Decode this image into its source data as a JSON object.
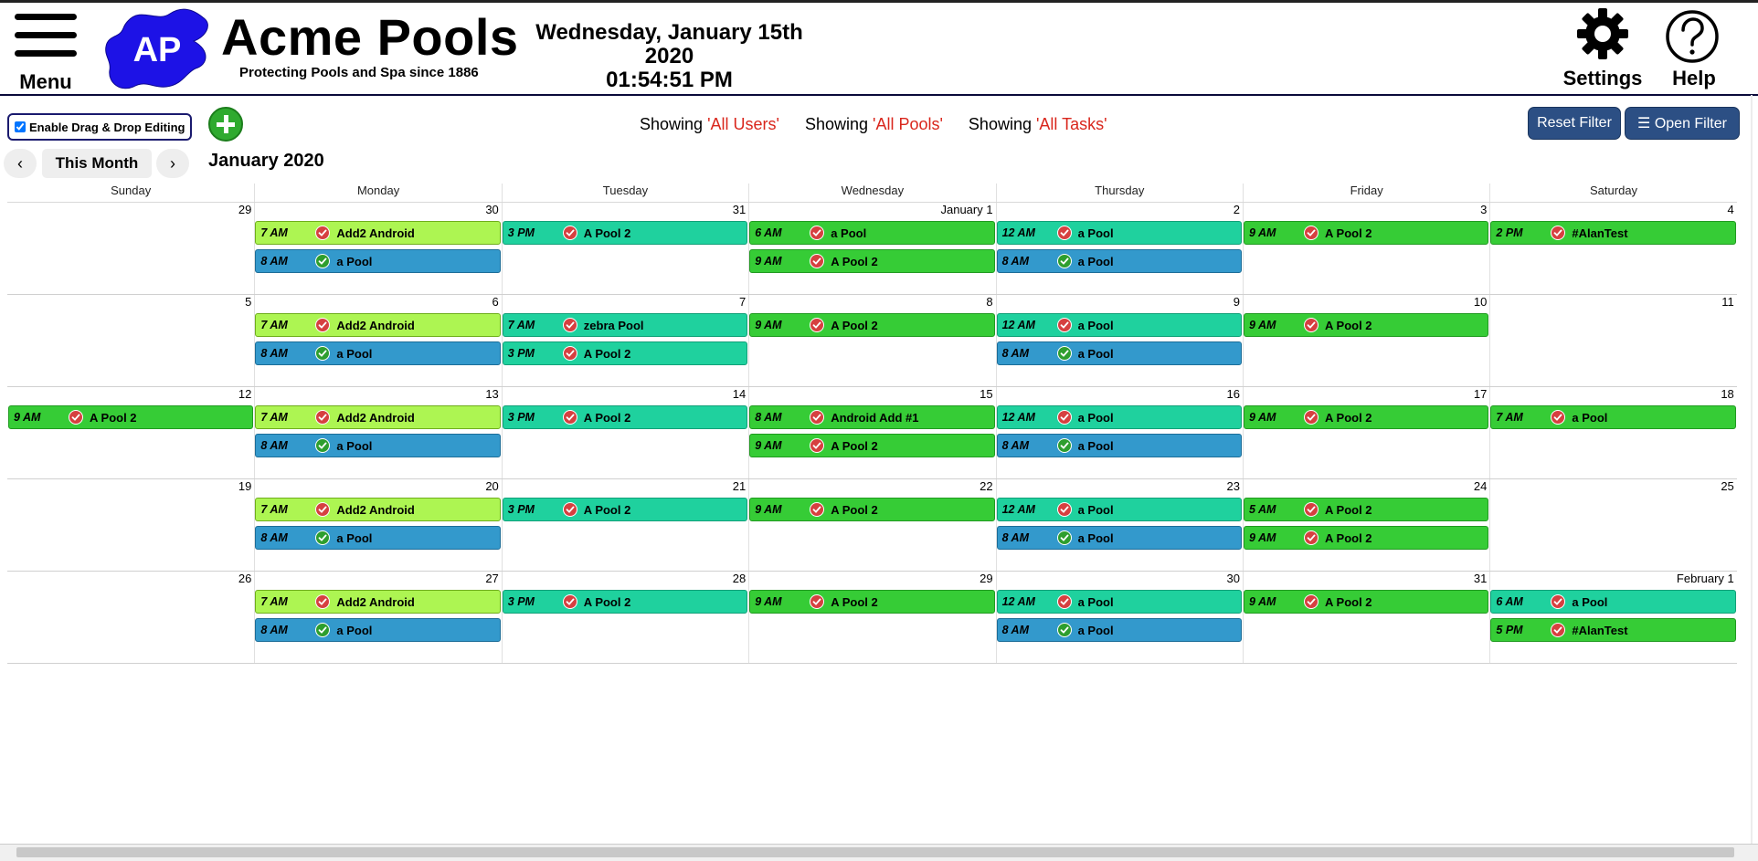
{
  "header": {
    "menu_label": "Menu",
    "logo_text": "AP",
    "brand": "Acme Pools",
    "tagline": "Protecting Pools and Spa since 1886",
    "date": "Wednesday, January 15th 2020",
    "time": "01:54:51 PM",
    "settings_label": "Settings",
    "help_label": "Help"
  },
  "toolbar": {
    "drag_drop_label": "Enable Drag & Drop Editing",
    "drag_drop_checked": true,
    "filters": [
      {
        "prefix": "Showing ",
        "value": "'All Users'"
      },
      {
        "prefix": "Showing ",
        "value": "'All Pools'"
      },
      {
        "prefix": "Showing ",
        "value": "'All Tasks'"
      }
    ],
    "reset_filter_label": "Reset Filter",
    "open_filter_label": "☰ Open Filter"
  },
  "nav": {
    "prev": "‹",
    "this_month": "This Month",
    "next": "›",
    "month_title": "January 2020"
  },
  "colors": {
    "lime": "#adf552",
    "teal": "#1fd19e",
    "green": "#36cc36",
    "blue": "#3399cc",
    "accent_red": "#d9261c",
    "button_blue": "#2c4f84"
  },
  "calendar": {
    "days_of_week": [
      "Sunday",
      "Monday",
      "Tuesday",
      "Wednesday",
      "Thursday",
      "Friday",
      "Saturday"
    ],
    "weeks": [
      {
        "days": [
          "29",
          "30",
          "31",
          "January 1",
          "2",
          "3",
          "4"
        ],
        "events": [
          {
            "day": 1,
            "row": 0,
            "span": 1,
            "time": "7 AM",
            "name": "Add2 Android",
            "color": "lime",
            "status": "red"
          },
          {
            "day": 1,
            "row": 1,
            "span": 1,
            "time": "8 AM",
            "name": "a Pool",
            "color": "blue",
            "status": "green"
          },
          {
            "day": 2,
            "row": 0,
            "span": 1,
            "time": "3 PM",
            "name": "A Pool 2",
            "color": "teal",
            "status": "red"
          },
          {
            "day": 3,
            "row": 0,
            "span": 1,
            "time": "6 AM",
            "name": "a Pool",
            "color": "green",
            "status": "red"
          },
          {
            "day": 3,
            "row": 1,
            "span": 1,
            "time": "9 AM",
            "name": "A Pool 2",
            "color": "green",
            "status": "red"
          },
          {
            "day": 4,
            "row": 0,
            "span": 1,
            "time": "12 AM",
            "name": "a Pool",
            "color": "teal",
            "status": "red"
          },
          {
            "day": 4,
            "row": 1,
            "span": 1,
            "time": "8 AM",
            "name": "a Pool",
            "color": "blue",
            "status": "green"
          },
          {
            "day": 5,
            "row": 0,
            "span": 1,
            "time": "9 AM",
            "name": "A Pool 2",
            "color": "green",
            "status": "red"
          },
          {
            "day": 6,
            "row": 0,
            "span": 1,
            "time": "2 PM",
            "name": "#AlanTest",
            "color": "green",
            "status": "red"
          }
        ]
      },
      {
        "days": [
          "5",
          "6",
          "7",
          "8",
          "9",
          "10",
          "11"
        ],
        "events": [
          {
            "day": 1,
            "row": 0,
            "span": 1,
            "time": "7 AM",
            "name": "Add2 Android",
            "color": "lime",
            "status": "red"
          },
          {
            "day": 1,
            "row": 1,
            "span": 1,
            "time": "8 AM",
            "name": "a Pool",
            "color": "blue",
            "status": "green"
          },
          {
            "day": 2,
            "row": 0,
            "span": 1,
            "time": "7 AM",
            "name": "zebra Pool",
            "color": "teal",
            "status": "red"
          },
          {
            "day": 2,
            "row": 1,
            "span": 1,
            "time": "3 PM",
            "name": "A Pool 2",
            "color": "teal",
            "status": "red"
          },
          {
            "day": 3,
            "row": 0,
            "span": 1,
            "time": "9 AM",
            "name": "A Pool 2",
            "color": "green",
            "status": "red"
          },
          {
            "day": 4,
            "row": 0,
            "span": 1,
            "time": "12 AM",
            "name": "a Pool",
            "color": "teal",
            "status": "red"
          },
          {
            "day": 4,
            "row": 1,
            "span": 1,
            "time": "8 AM",
            "name": "a Pool",
            "color": "blue",
            "status": "green"
          },
          {
            "day": 5,
            "row": 0,
            "span": 1,
            "time": "9 AM",
            "name": "A Pool 2",
            "color": "green",
            "status": "red"
          }
        ]
      },
      {
        "days": [
          "12",
          "13",
          "14",
          "15",
          "16",
          "17",
          "18"
        ],
        "events": [
          {
            "day": 0,
            "row": 0,
            "span": 1,
            "time": "9 AM",
            "name": "A Pool 2",
            "color": "green",
            "status": "red"
          },
          {
            "day": 1,
            "row": 0,
            "span": 1,
            "time": "7 AM",
            "name": "Add2 Android",
            "color": "lime",
            "status": "red"
          },
          {
            "day": 1,
            "row": 1,
            "span": 1,
            "time": "8 AM",
            "name": "a Pool",
            "color": "blue",
            "status": "green"
          },
          {
            "day": 2,
            "row": 0,
            "span": 1,
            "time": "3 PM",
            "name": "A Pool 2",
            "color": "teal",
            "status": "red"
          },
          {
            "day": 3,
            "row": 0,
            "span": 1,
            "time": "8 AM",
            "name": "Android Add #1",
            "color": "green",
            "status": "red"
          },
          {
            "day": 3,
            "row": 1,
            "span": 1,
            "time": "9 AM",
            "name": "A Pool 2",
            "color": "green",
            "status": "red"
          },
          {
            "day": 4,
            "row": 0,
            "span": 1,
            "time": "12 AM",
            "name": "a Pool",
            "color": "teal",
            "status": "red"
          },
          {
            "day": 4,
            "row": 1,
            "span": 1,
            "time": "8 AM",
            "name": "a Pool",
            "color": "blue",
            "status": "green"
          },
          {
            "day": 5,
            "row": 0,
            "span": 1,
            "time": "9 AM",
            "name": "A Pool 2",
            "color": "green",
            "status": "red"
          },
          {
            "day": 6,
            "row": 0,
            "span": 1,
            "time": "7 AM",
            "name": "a Pool",
            "color": "green",
            "status": "red"
          }
        ]
      },
      {
        "days": [
          "19",
          "20",
          "21",
          "22",
          "23",
          "24",
          "25"
        ],
        "events": [
          {
            "day": 1,
            "row": 0,
            "span": 1,
            "time": "7 AM",
            "name": "Add2 Android",
            "color": "lime",
            "status": "red"
          },
          {
            "day": 1,
            "row": 1,
            "span": 1,
            "time": "8 AM",
            "name": "a Pool",
            "color": "blue",
            "status": "green"
          },
          {
            "day": 2,
            "row": 0,
            "span": 1,
            "time": "3 PM",
            "name": "A Pool 2",
            "color": "teal",
            "status": "red"
          },
          {
            "day": 3,
            "row": 0,
            "span": 1,
            "time": "9 AM",
            "name": "A Pool 2",
            "color": "green",
            "status": "red"
          },
          {
            "day": 4,
            "row": 0,
            "span": 1,
            "time": "12 AM",
            "name": "a Pool",
            "color": "teal",
            "status": "red"
          },
          {
            "day": 4,
            "row": 1,
            "span": 1,
            "time": "8 AM",
            "name": "a Pool",
            "color": "blue",
            "status": "green"
          },
          {
            "day": 5,
            "row": 0,
            "span": 1,
            "time": "5 AM",
            "name": "A Pool 2",
            "color": "green",
            "status": "red"
          },
          {
            "day": 5,
            "row": 1,
            "span": 1,
            "time": "9 AM",
            "name": "A Pool 2",
            "color": "green",
            "status": "red"
          }
        ]
      },
      {
        "days": [
          "26",
          "27",
          "28",
          "29",
          "30",
          "31",
          "February 1"
        ],
        "events": [
          {
            "day": 1,
            "row": 0,
            "span": 1,
            "time": "7 AM",
            "name": "Add2 Android",
            "color": "lime",
            "status": "red"
          },
          {
            "day": 1,
            "row": 1,
            "span": 1,
            "time": "8 AM",
            "name": "a Pool",
            "color": "blue",
            "status": "green"
          },
          {
            "day": 2,
            "row": 0,
            "span": 1,
            "time": "3 PM",
            "name": "A Pool 2",
            "color": "teal",
            "status": "red"
          },
          {
            "day": 3,
            "row": 0,
            "span": 1,
            "time": "9 AM",
            "name": "A Pool 2",
            "color": "green",
            "status": "red"
          },
          {
            "day": 4,
            "row": 0,
            "span": 1,
            "time": "12 AM",
            "name": "a Pool",
            "color": "teal",
            "status": "red"
          },
          {
            "day": 4,
            "row": 1,
            "span": 1,
            "time": "8 AM",
            "name": "a Pool",
            "color": "blue",
            "status": "green"
          },
          {
            "day": 5,
            "row": 0,
            "span": 1,
            "time": "9 AM",
            "name": "A Pool 2",
            "color": "green",
            "status": "red"
          },
          {
            "day": 6,
            "row": 0,
            "span": 1,
            "time": "6 AM",
            "name": "a Pool",
            "color": "teal",
            "status": "red"
          },
          {
            "day": 6,
            "row": 1,
            "span": 1,
            "time": "5 PM",
            "name": "#AlanTest",
            "color": "green",
            "status": "red"
          }
        ]
      }
    ]
  }
}
